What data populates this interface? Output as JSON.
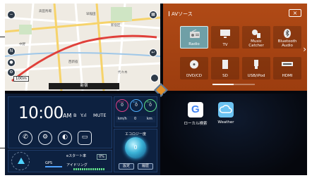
{
  "map": {
    "scale": "100m",
    "street": "新宿",
    "labels": [
      "高田馬場",
      "新宿区",
      "中野",
      "早稲田",
      "西新宿",
      "代々木"
    ]
  },
  "av": {
    "title": "AVソース",
    "close": "×",
    "next": "›",
    "tiles": [
      {
        "label": "Radio",
        "icon": "radio-icon"
      },
      {
        "label": "TV",
        "icon": "tv-icon"
      },
      {
        "label": "Music\nCatcher",
        "icon": "music-catcher-icon"
      },
      {
        "label": "Bluetooth\nAudio",
        "icon": "bluetooth-icon"
      },
      {
        "label": "DVD/CD",
        "icon": "disc-icon"
      },
      {
        "label": "SD",
        "icon": "sd-card-icon"
      },
      {
        "label": "USB/iPod",
        "icon": "usb-icon"
      },
      {
        "label": "HDMI",
        "icon": "hdmi-icon"
      }
    ]
  },
  "info": {
    "time": "10:00",
    "ampm": "AM",
    "bt": "B",
    "signal": "Y.ıl",
    "mute": "MUTE",
    "gauges": [
      {
        "label": "max",
        "value": "0",
        "color": "#e0408a"
      },
      {
        "label": "avg",
        "value": "0",
        "color": "#4fb0ff"
      },
      {
        "label": "eco",
        "value": "0",
        "color": "#5fe08a"
      }
    ],
    "gauge_row": [
      "km/h",
      "0",
      "km"
    ],
    "eco_title": "エコロジー度",
    "eco_value": "0",
    "eco_buttons": [
      "設定",
      "履歴"
    ],
    "gps": "GPS",
    "eco_start": "eスタート率",
    "eco_start_val": "0%",
    "idle": "アイドリング"
  },
  "apps": [
    {
      "label": "ローカル検索",
      "icon": "google-icon"
    },
    {
      "label": "Weather",
      "icon": "weather-icon"
    }
  ],
  "colors": {
    "av_bg": "#a8431a",
    "info_bg": "#0c1a33",
    "accent": "#e2902a"
  }
}
